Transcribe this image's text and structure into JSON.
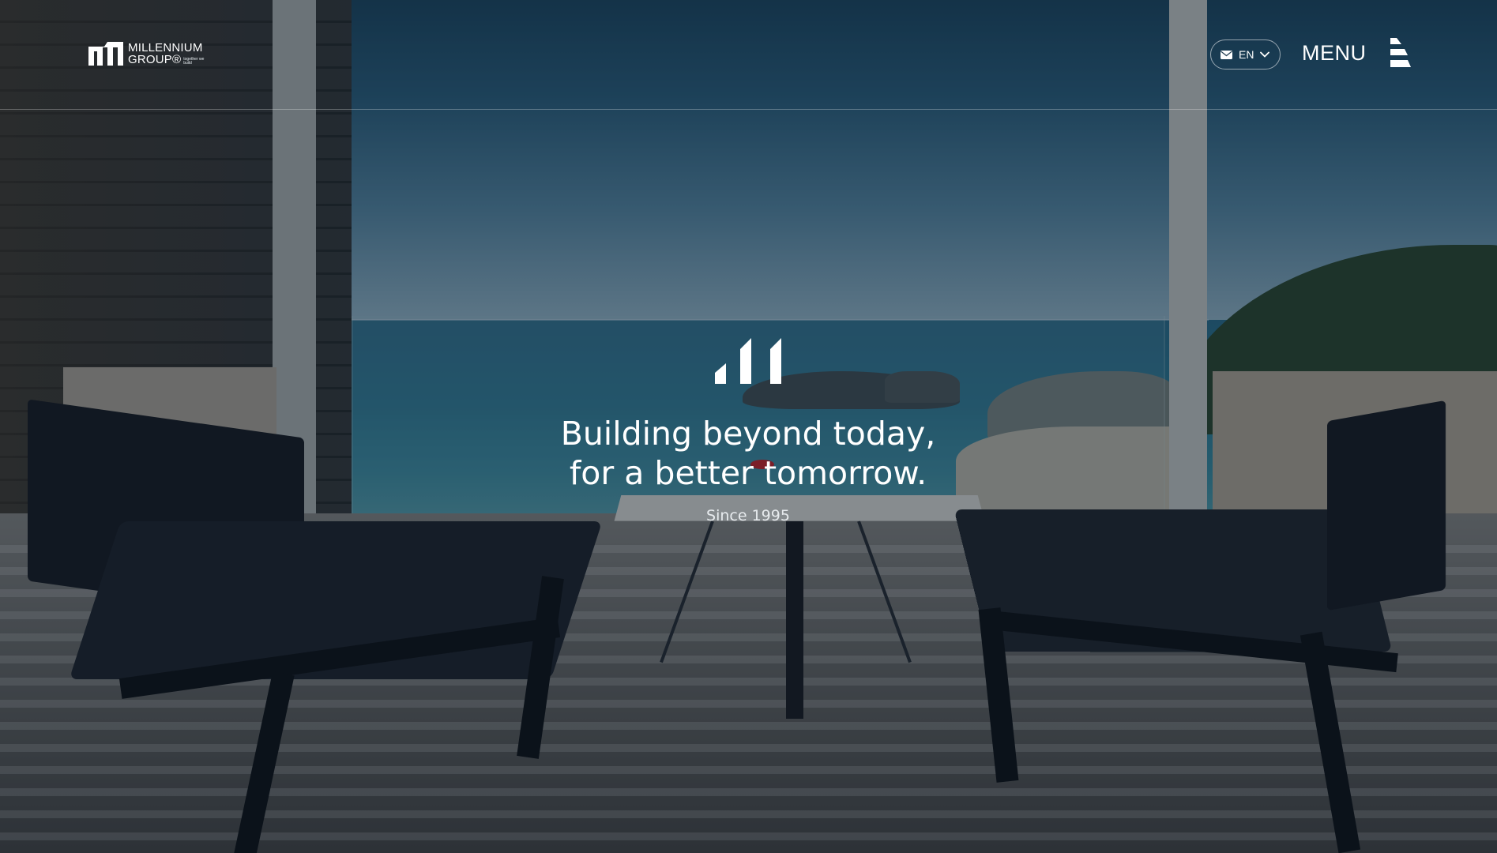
{
  "header": {
    "logo": {
      "line1": "MILLENNIUM",
      "line2": "GROUP®",
      "tagline": "together we build",
      "mark_icon": "millennium-logo-mark"
    },
    "language": {
      "icon": "mail-icon",
      "selected": "EN",
      "chevron_icon": "chevron-down-icon"
    },
    "menu": {
      "label": "MENU",
      "icon": "menu-icon"
    }
  },
  "hero": {
    "mark_icon": "millennium-bars-mark",
    "headline_line1": "Building beyond today,",
    "headline_line2": "for a better tomorrow.",
    "since": "Since 1995"
  },
  "colors": {
    "text": "#ffffff",
    "overlay": "#05141f",
    "divider": "#ffffff"
  }
}
